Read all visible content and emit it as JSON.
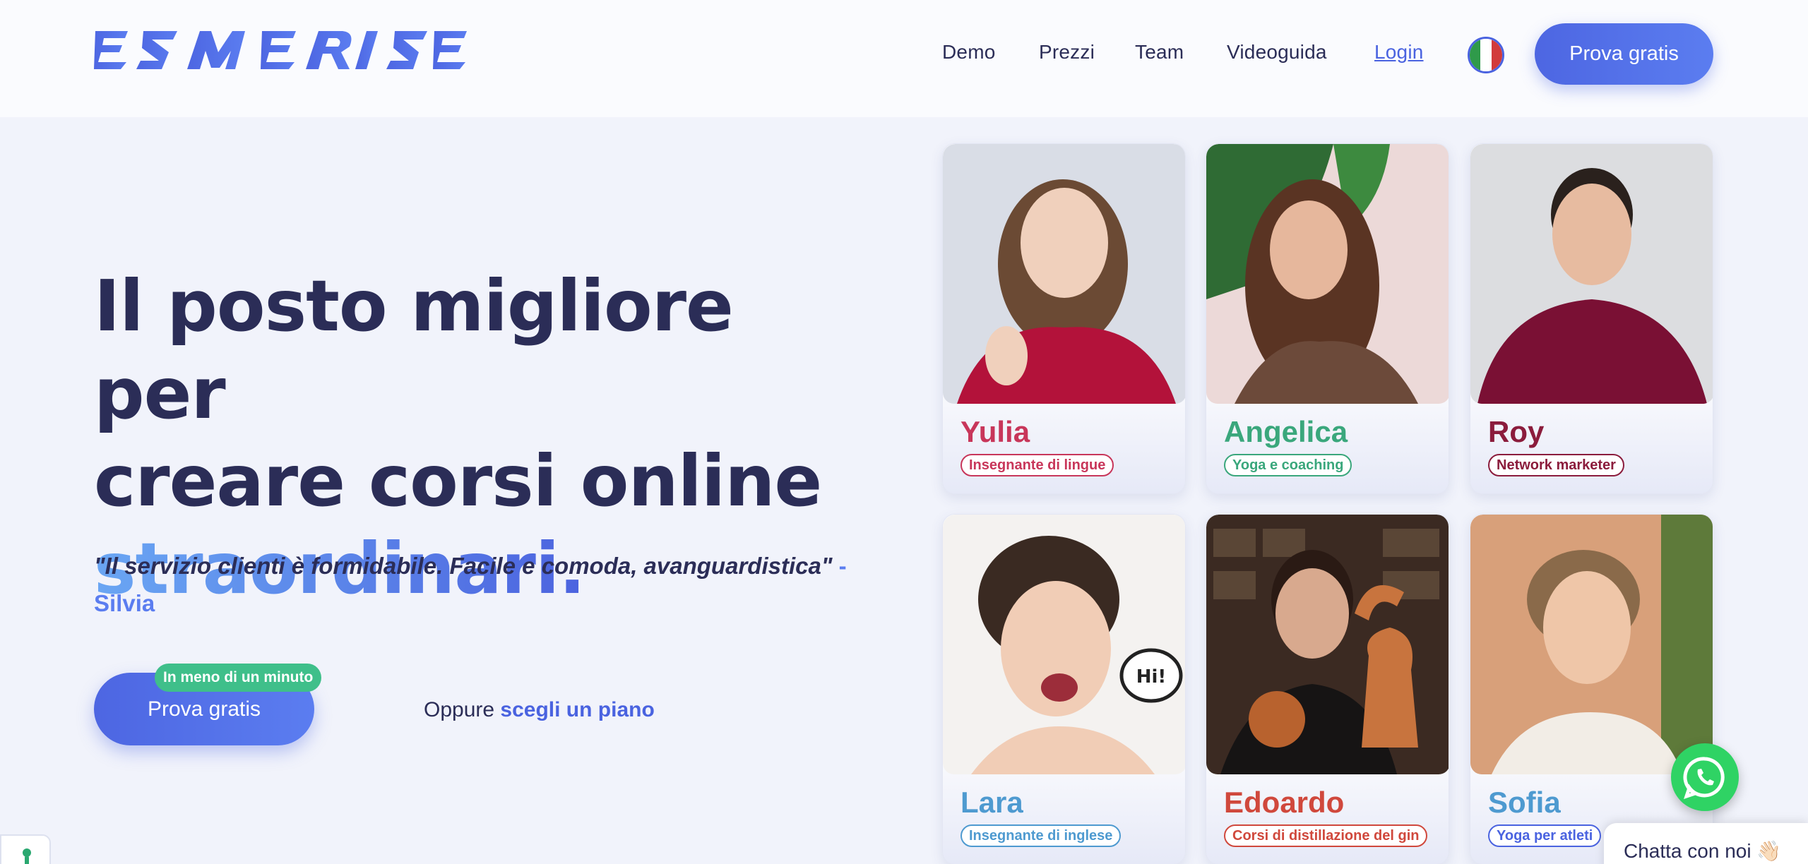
{
  "brand": {
    "logo_text": "ESMERISE",
    "primary": "#4d66e2",
    "dark": "#2b2d57",
    "green": "#3fbf8a"
  },
  "nav": {
    "items": [
      {
        "label": "Demo"
      },
      {
        "label": "Prezzi"
      },
      {
        "label": "Team"
      },
      {
        "label": "Videoguida"
      }
    ],
    "login": "Login",
    "language_icon": "italy-flag-icon",
    "cta": "Prova gratis"
  },
  "hero": {
    "title_line1": "Il posto migliore per",
    "title_line2": "creare corsi online",
    "title_accent": "straordinari.",
    "quote": "\"Il servizio clienti è formidabile. Facile e comoda, avanguardistica\"",
    "quote_separator": " -",
    "quote_author": "Silvia",
    "cta_label": "Prova gratis",
    "cta_badge": "In meno di un minuto",
    "alt_prefix": "Oppure",
    "alt_link": "scegli un piano"
  },
  "cards": [
    {
      "name": "Yulia",
      "role": "Insegnante di lingue",
      "color": "#c8365a"
    },
    {
      "name": "Angelica",
      "role": "Yoga e coaching",
      "color": "#3aa77c"
    },
    {
      "name": "Roy",
      "role": "Network marketer",
      "color": "#8b1c3c"
    },
    {
      "name": "Lara",
      "role": "Insegnante di inglese",
      "color": "#4e9ad0",
      "bubble": "Hi!"
    },
    {
      "name": "Edoardo",
      "role": "Corsi di distillazione del gin",
      "color": "#d0483c"
    },
    {
      "name": "Sofia",
      "role": "Yoga per atleti",
      "color": "#4a63e0"
    }
  ],
  "chat": {
    "label": "Chatta con noi 👋🏻",
    "whatsapp_icon": "whatsapp-icon"
  },
  "accessibility_icon": "accessibility-icon"
}
